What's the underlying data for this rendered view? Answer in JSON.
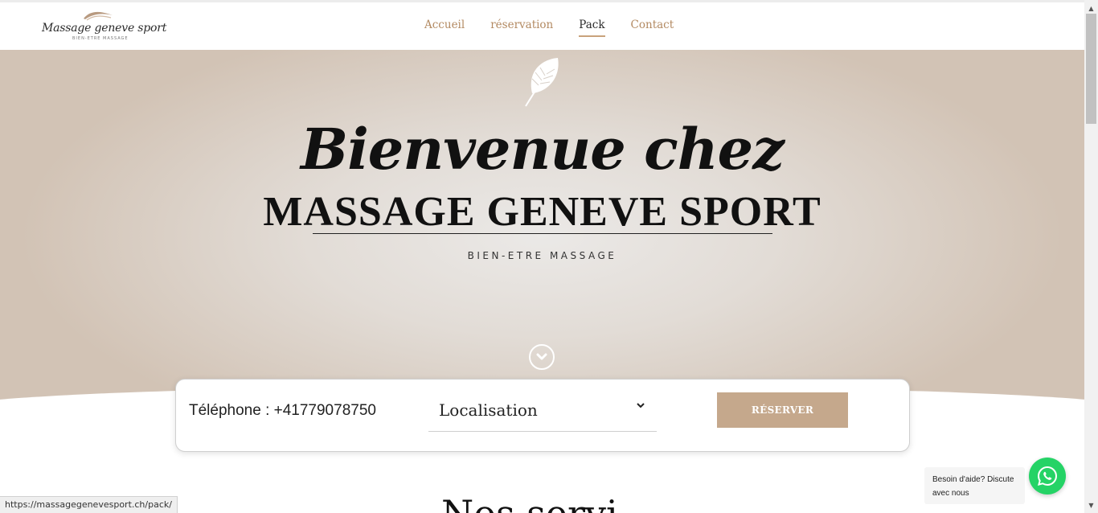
{
  "brand": {
    "logo_text": "Massage geneve sport",
    "logo_tagline": "BIEN-ETRE MASSAGE"
  },
  "nav": {
    "items": [
      {
        "label": "Accueil",
        "active": false
      },
      {
        "label": "réservation",
        "active": false
      },
      {
        "label": "Pack",
        "active": true
      },
      {
        "label": "Contact",
        "active": false
      }
    ]
  },
  "hero": {
    "title": "Bienvenue chez",
    "subtitle": "MASSAGE GENEVE SPORT",
    "tagline": "BIEN-ETRE MASSAGE",
    "leaf_icon": "leaf-icon",
    "scroll_icon": "chevron-down-circle-icon"
  },
  "booking": {
    "phone_text": "Téléphone : +41779078750",
    "location_value": "Localisation",
    "location_chevron": "⌄",
    "reserve_label": "RÉSERVER"
  },
  "section": {
    "heading_partial": "Nos servi"
  },
  "whatsapp": {
    "help_text": "Besoin d'aide? Discute avec nous",
    "icon": "whatsapp-icon"
  },
  "status_bar": {
    "url": "https://massagegenevesport.ch/pack/"
  },
  "colors": {
    "accent": "#b38a62",
    "button": "#c5a88c",
    "whatsapp": "#25d366"
  }
}
